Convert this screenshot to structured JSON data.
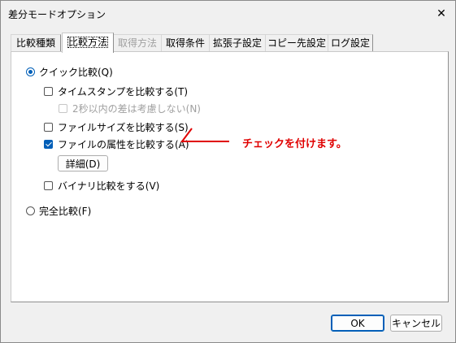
{
  "window": {
    "title": "差分モードオプション",
    "close_glyph": "✕"
  },
  "tabs": [
    {
      "label": "比較種類",
      "state": "normal"
    },
    {
      "label": "比較方法",
      "state": "active"
    },
    {
      "label": "取得方法",
      "state": "disabled"
    },
    {
      "label": "取得条件",
      "state": "normal"
    },
    {
      "label": "拡張子設定",
      "state": "normal"
    },
    {
      "label": "コピー先設定",
      "state": "normal"
    },
    {
      "label": "ログ設定",
      "state": "normal"
    }
  ],
  "options": {
    "quick_compare": {
      "label": "クイック比較(Q)",
      "checked": true
    },
    "timestamp": {
      "label": "タイムスタンプを比較する(T)",
      "checked": false
    },
    "two_sec_diff": {
      "label": "2秒以内の差は考慮しない(N)",
      "checked": false,
      "disabled": true
    },
    "file_size": {
      "label": "ファイルサイズを比較する(S)",
      "checked": false
    },
    "file_attr": {
      "label": "ファイルの属性を比較する(A)",
      "checked": true
    },
    "details_button": "詳細(D)",
    "binary_compare": {
      "label": "バイナリ比較をする(V)",
      "checked": false
    },
    "full_compare": {
      "label": "完全比較(F)",
      "checked": false
    }
  },
  "annotation": {
    "text": "チェックを付けます。",
    "color": "#e00000"
  },
  "footer": {
    "ok_label": "OK",
    "cancel_label": "キャンセル"
  }
}
